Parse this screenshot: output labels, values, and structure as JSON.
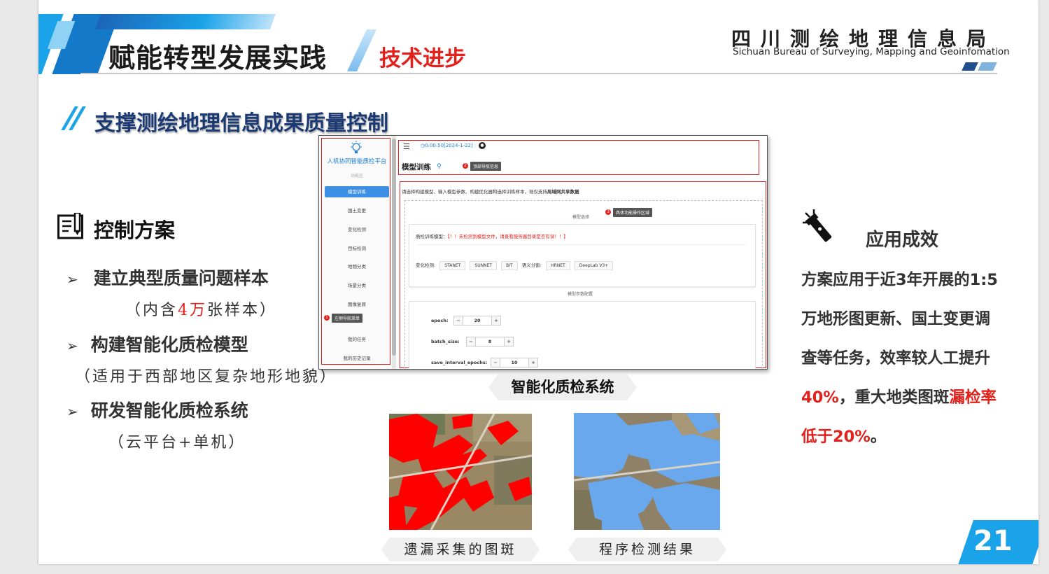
{
  "header": {
    "title": "赋能转型发展实践",
    "subtitle": "技术进步",
    "org_cn": "四川测绘地理信息局",
    "org_en": "Sichuan Bureau of Surveying, Mapping and Geoinfomation"
  },
  "section_title": "支撑测绘地理信息成果质量控制",
  "plan": {
    "title": "控制方案",
    "items": [
      {
        "label": "建立典型质量问题样本",
        "note_pre": "（内含",
        "note_hl": "4万",
        "note_post": "张样本）"
      },
      {
        "label": "构建智能化质检模型",
        "note": "（适用于西部地区复杂地形地貌）"
      },
      {
        "label": "研发智能化质检系统",
        "note": "（云平台+单机）"
      }
    ]
  },
  "screenshot": {
    "platform_name": "人机协同智能质检平台",
    "sidebar_section": "功能区",
    "sidebar_items": [
      "模型训练",
      "国土变更",
      "变化检测",
      "目标检测",
      "地物分类",
      "场景分类",
      "图像复原",
      "我的任务",
      "我的历史记录"
    ],
    "active_item": "模型训练",
    "topbar_time": "0:00:50[2024-1-22]",
    "page_title": "模型训练",
    "tip_top": "顶部导航信息",
    "tip_left": "左侧导航菜单",
    "tip_area": "具体功能操作区域",
    "badge_2": "2",
    "badge_1": "1",
    "badge_3": "3",
    "intro_text": "请选择构建模型、输入模型参数、构建优化器和选择训练样本，现仅支持",
    "intro_bold": "局域网共享数据",
    "model_select_label": "模型选择",
    "model_field_label": "质检训练模型：",
    "model_warning": "【！！未检测到模型文件，请查看服务器目录是否有误！！】",
    "change_detect_label": "变化检测:",
    "change_detect_models": [
      "STANET",
      "SUNNET",
      "BIT"
    ],
    "seg_label": "语义分割:",
    "seg_models": [
      "HRNET",
      "DeepLab V3+"
    ],
    "param_section": "模型参数配置",
    "params": [
      {
        "name": "epoch:",
        "value": "20"
      },
      {
        "name": "batch_size:",
        "value": "8"
      },
      {
        "name": "save_interval_epochs:",
        "value": "10"
      }
    ],
    "minus": "−",
    "plus": "+"
  },
  "system_label": "智能化质检系统",
  "captions": {
    "left": "遗漏采集的图斑",
    "right": "程序检测结果"
  },
  "results": {
    "title": "应用成效",
    "line1": "方案应用于近3年开展的1:5",
    "line2": "万地形图更新、国土变更调",
    "line3": "查等任务，效率较人工提升",
    "line4_hl": "40%",
    "line4_mid": "，重大地类图斑",
    "line4_hl2": "漏检率",
    "line5_hl": "低于20%",
    "line5_end": "。"
  },
  "page_number": "21",
  "colors": {
    "accent_blue": "#1aa3e8",
    "accent_red": "#e3201b",
    "title_navy": "#1b3a73",
    "overlay_red": "#ff0000",
    "overlay_blue": "#6aa8ee"
  },
  "icons": [
    "document-pen-icon",
    "flashlight-icon",
    "lightbulb-icon",
    "github-icon",
    "clock-icon",
    "menu-icon"
  ]
}
